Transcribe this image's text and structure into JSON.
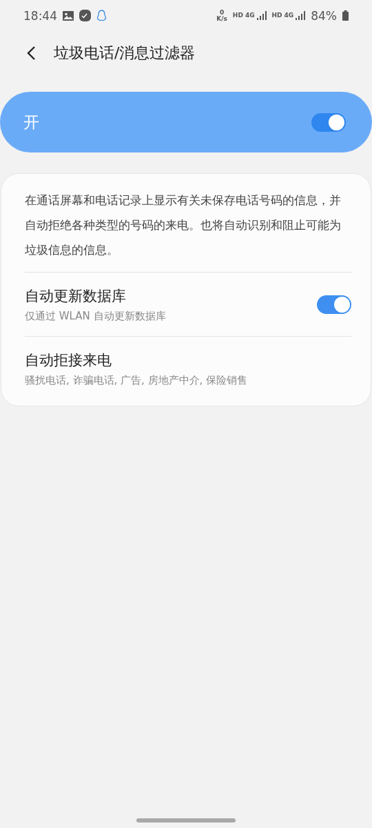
{
  "status_bar": {
    "time": "18:44",
    "speed_value": "0",
    "speed_unit": "K/s",
    "networks": [
      {
        "hd": "HD",
        "type": "4G"
      },
      {
        "hd": "HD",
        "type": "4G"
      }
    ],
    "battery": "84%"
  },
  "header": {
    "title": "垃圾电话/消息过滤器"
  },
  "master_switch": {
    "label": "开",
    "on": true
  },
  "description": "在通话屏幕和电话记录上显示有关未保存电话号码的信息，并自动拒绝各种类型的号码的来电。也将自动识别和阻止可能为垃圾信息的信息。",
  "settings": [
    {
      "kind": "toggle",
      "title": "自动更新数据库",
      "subtitle": "仅通过 WLAN 自动更新数据库",
      "on": true
    },
    {
      "kind": "plain",
      "title": "自动拒接来电",
      "subtitle": "骚扰电话, 诈骗电话, 广告, 房地产中介, 保险销售"
    }
  ]
}
